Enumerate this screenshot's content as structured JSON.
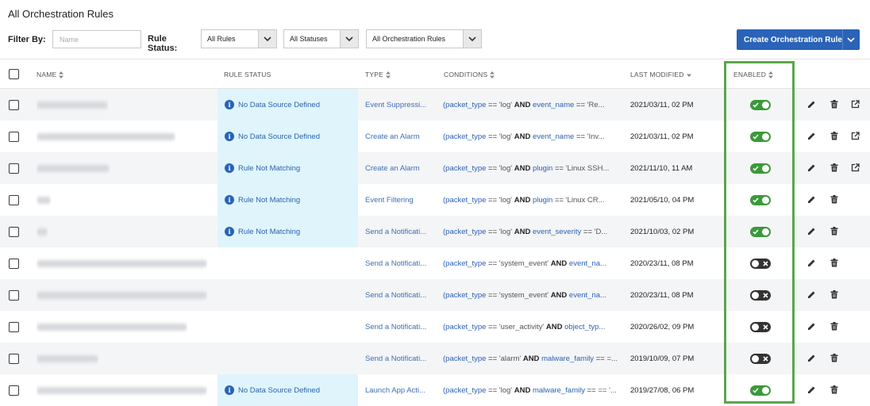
{
  "page": {
    "title": "All Orchestration Rules"
  },
  "filter": {
    "label": "Filter By:",
    "name_placeholder": "Name",
    "status_label": "Rule Status:",
    "dropdowns": [
      {
        "value": "All Rules"
      },
      {
        "value": "All Statuses"
      },
      {
        "value": "All Orchestration Rules"
      }
    ]
  },
  "create_button": {
    "label": "Create Orchestration Rule"
  },
  "columns": {
    "name": "NAME",
    "rule_status": "RULE STATUS",
    "type": "TYPE",
    "conditions": "CONDITIONS",
    "last_modified": "LAST MODIFIED",
    "enabled": "ENABLED"
  },
  "rows": [
    {
      "status": "No Data Source Defined",
      "type": "Event Suppressi...",
      "cond": {
        "field2": "event_name",
        "v1": "'log'",
        "v2": "'Re...",
        "k1": "packet_type"
      },
      "date": "2021/03/11, 02 PM",
      "enabled": true,
      "external": true
    },
    {
      "status": "No Data Source Defined",
      "type": "Create an Alarm",
      "cond": {
        "k1": "packet_type",
        "v1": "'log'",
        "field2": "event_name",
        "v2": "'Inv..."
      },
      "date": "2021/03/11, 02 PM",
      "enabled": true,
      "external": true
    },
    {
      "status": "Rule Not Matching",
      "type": "Create an Alarm",
      "cond": {
        "k1": "packet_type",
        "v1": "'log'",
        "field2": "plugin",
        "v2": "'Linux SSH..."
      },
      "date": "2021/11/10, 11 AM",
      "enabled": true,
      "external": true
    },
    {
      "status": "Rule Not Matching",
      "type": "Event Filtering",
      "cond": {
        "k1": "packet_type",
        "v1": "'log'",
        "field2": "plugin",
        "v2": "'Linux CR..."
      },
      "date": "2021/05/10, 04 PM",
      "enabled": true,
      "external": false
    },
    {
      "status": "Rule Not Matching",
      "type": "Send a Notificati...",
      "cond": {
        "k1": "packet_type",
        "v1": "'log'",
        "field2": "event_severity",
        "v2": "'D..."
      },
      "date": "2021/10/03, 02 PM",
      "enabled": true,
      "external": false
    },
    {
      "status": "",
      "type": "Send a Notificati...",
      "cond": {
        "k1": "packet_type",
        "v1": "'system_event'",
        "field2": "event_na...",
        "v2": ""
      },
      "date": "2020/23/11, 08 PM",
      "enabled": false,
      "external": false
    },
    {
      "status": "",
      "type": "Send a Notificati...",
      "cond": {
        "k1": "packet_type",
        "v1": "'system_event'",
        "field2": "event_na...",
        "v2": ""
      },
      "date": "2020/23/11, 08 PM",
      "enabled": false,
      "external": false
    },
    {
      "status": "",
      "type": "Send a Notificati...",
      "cond": {
        "k1": "packet_type",
        "v1": "'user_activity'",
        "field2": "object_typ...",
        "v2": ""
      },
      "date": "2020/26/02, 09 PM",
      "enabled": false,
      "external": false
    },
    {
      "status": "",
      "type": "Send a Notificati...",
      "cond": {
        "k1": "packet_type",
        "v1": "'alarm'",
        "field2": "malware_family",
        "v2": "=..."
      },
      "date": "2019/10/09, 07 PM",
      "enabled": false,
      "external": false
    },
    {
      "status": "No Data Source Defined",
      "type": "Launch App Acti...",
      "cond": {
        "k1": "packet_type",
        "v1": "'log'",
        "field2": "malware_family",
        "v2": "== '..."
      },
      "date": "2019/27/08, 06 PM",
      "enabled": true,
      "external": false
    }
  ],
  "text": {
    "and": "AND",
    "eq": "==",
    "open_paren": "("
  },
  "colors": {
    "accent": "#2a63b7",
    "status_bg": "#dff5fb",
    "toggle_on": "#3a9a3a",
    "toggle_off": "#333333",
    "highlight": "#5aa64b"
  }
}
